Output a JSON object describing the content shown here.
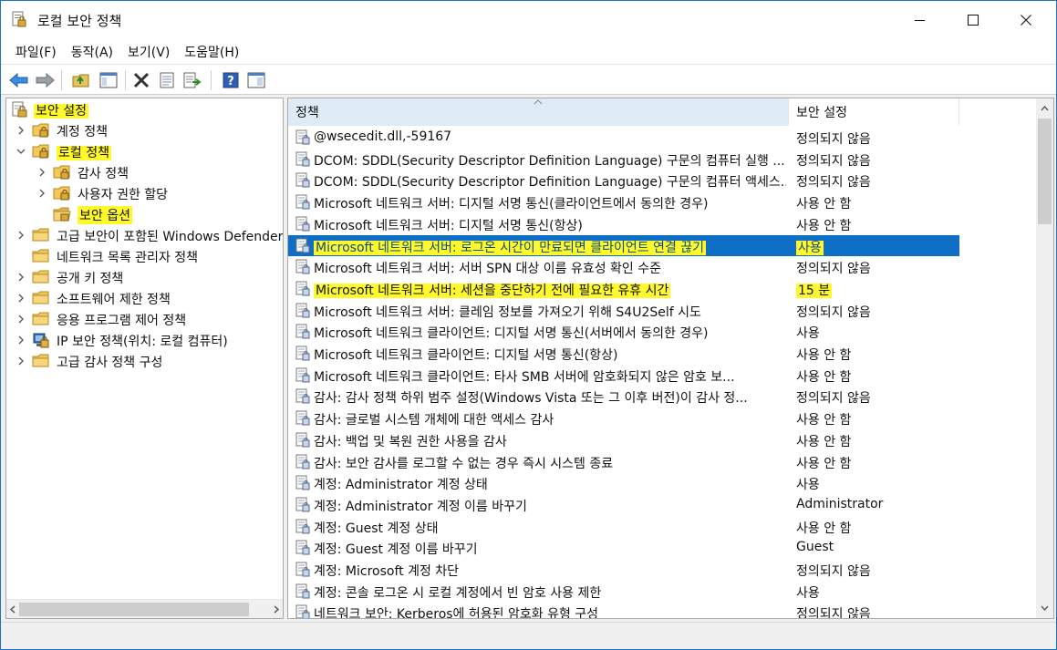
{
  "window": {
    "title": "로컬 보안 정책",
    "controls": {
      "minimize_icon": "minimize-icon",
      "maximize_icon": "maximize-icon",
      "close_icon": "close-icon"
    }
  },
  "menubar": {
    "items": [
      {
        "label": "파일(F)"
      },
      {
        "label": "동작(A)"
      },
      {
        "label": "보기(V)"
      },
      {
        "label": "도움말(H)"
      }
    ]
  },
  "toolbar": {
    "buttons": [
      "back-icon",
      "forward-icon",
      "up-folder-icon",
      "show-tree-icon",
      "delete-icon",
      "properties-icon",
      "export-icon",
      "help-icon",
      "console-icon"
    ]
  },
  "tree": {
    "items": [
      {
        "label": "보안 설정",
        "highlighted": true,
        "icon": "security-settings-icon"
      },
      {
        "label": "계정 정책",
        "icon": "locked-folder-icon"
      },
      {
        "label": "로컬 정책",
        "highlighted": true,
        "icon": "locked-folder-icon"
      },
      {
        "label": "감사 정책",
        "icon": "locked-folder-icon"
      },
      {
        "label": "사용자 권한 할당",
        "icon": "locked-folder-icon"
      },
      {
        "label": "보안 옵션",
        "highlighted": true,
        "selected": true,
        "icon": "open-folder-icon"
      },
      {
        "label": "고급 보안이 포함된 Windows Defender 방화벽",
        "icon": "folder-icon"
      },
      {
        "label": "네트워크 목록 관리자 정책",
        "icon": "folder-icon"
      },
      {
        "label": "공개 키 정책",
        "icon": "folder-icon"
      },
      {
        "label": "소프트웨어 제한 정책",
        "icon": "folder-icon"
      },
      {
        "label": "응용 프로그램 제어 정책",
        "icon": "folder-icon"
      },
      {
        "label": "IP 보안 정책(위치: 로컬 컴퓨터)",
        "icon": "ip-security-icon"
      },
      {
        "label": "고급 감사 정책 구성",
        "icon": "folder-icon"
      }
    ]
  },
  "list": {
    "headers": {
      "policy": "정책",
      "setting": "보안 설정"
    },
    "rows": [
      {
        "policy": "@wsecedit.dll,-59167",
        "setting": "정의되지 않음"
      },
      {
        "policy": "DCOM: SDDL(Security Descriptor Definition Language) 구문의 컴퓨터 실행 ...",
        "setting": "정의되지 않음"
      },
      {
        "policy": "DCOM: SDDL(Security Descriptor Definition Language) 구문의 컴퓨터 액세스...",
        "setting": "정의되지 않음"
      },
      {
        "policy": "Microsoft 네트워크 서버: 디지털 서명 통신(클라이언트에서 동의한 경우)",
        "setting": "사용 안 함"
      },
      {
        "policy": "Microsoft 네트워크 서버: 디지털 서명 통신(항상)",
        "setting": "사용 안 함"
      },
      {
        "policy": "Microsoft 네트워크 서버: 로그온 시간이 만료되면 클라이언트 연결 끊기",
        "setting": "사용",
        "selected": true,
        "highlighted": true
      },
      {
        "policy": "Microsoft 네트워크 서버: 서버 SPN 대상 이름 유효성 확인 수준",
        "setting": "정의되지 않음"
      },
      {
        "policy": "Microsoft 네트워크 서버: 세션을 중단하기 전에 필요한 유휴 시간",
        "setting": "15 분",
        "highlighted": true
      },
      {
        "policy": "Microsoft 네트워크 서버: 클레임 정보를 가져오기 위해 S4U2Self 시도",
        "setting": "정의되지 않음"
      },
      {
        "policy": "Microsoft 네트워크 클라이언트: 디지털 서명 통신(서버에서 동의한 경우)",
        "setting": "사용"
      },
      {
        "policy": "Microsoft 네트워크 클라이언트: 디지털 서명 통신(항상)",
        "setting": "사용 안 함"
      },
      {
        "policy": "Microsoft 네트워크 클라이언트: 타사 SMB 서버에 암호화되지 않은 암호 보...",
        "setting": "사용 안 함"
      },
      {
        "policy": "감사: 감사 정책 하위 범주 설정(Windows Vista 또는 그 이후 버전)이 감사 정...",
        "setting": "정의되지 않음"
      },
      {
        "policy": "감사: 글로벌 시스템 개체에 대한 액세스 감사",
        "setting": "사용 안 함"
      },
      {
        "policy": "감사: 백업 및 복원 권한 사용을 감사",
        "setting": "사용 안 함"
      },
      {
        "policy": "감사: 보안 감사를 로그할 수 없는 경우 즉시 시스템 종료",
        "setting": "사용 안 함"
      },
      {
        "policy": "계정: Administrator 계정 상태",
        "setting": "사용"
      },
      {
        "policy": "계정: Administrator 계정 이름 바꾸기",
        "setting": "Administrator"
      },
      {
        "policy": "계정: Guest 계정 상태",
        "setting": "사용 안 함"
      },
      {
        "policy": "계정: Guest 계정 이름 바꾸기",
        "setting": "Guest"
      },
      {
        "policy": "계정: Microsoft 계정 차단",
        "setting": "정의되지 않음"
      },
      {
        "policy": "계정: 콘솔 로그온 시 로컬 계정에서 빈 암호 사용 제한",
        "setting": "사용"
      },
      {
        "policy": "네트워크 보안: Kerberos에 허용된 암호화 유형 구성",
        "setting": "정의되지 않음"
      }
    ]
  },
  "colors": {
    "selection": "#0f6fc7",
    "highlight": "#fff82a",
    "header_hover": "#dfeaf7"
  }
}
